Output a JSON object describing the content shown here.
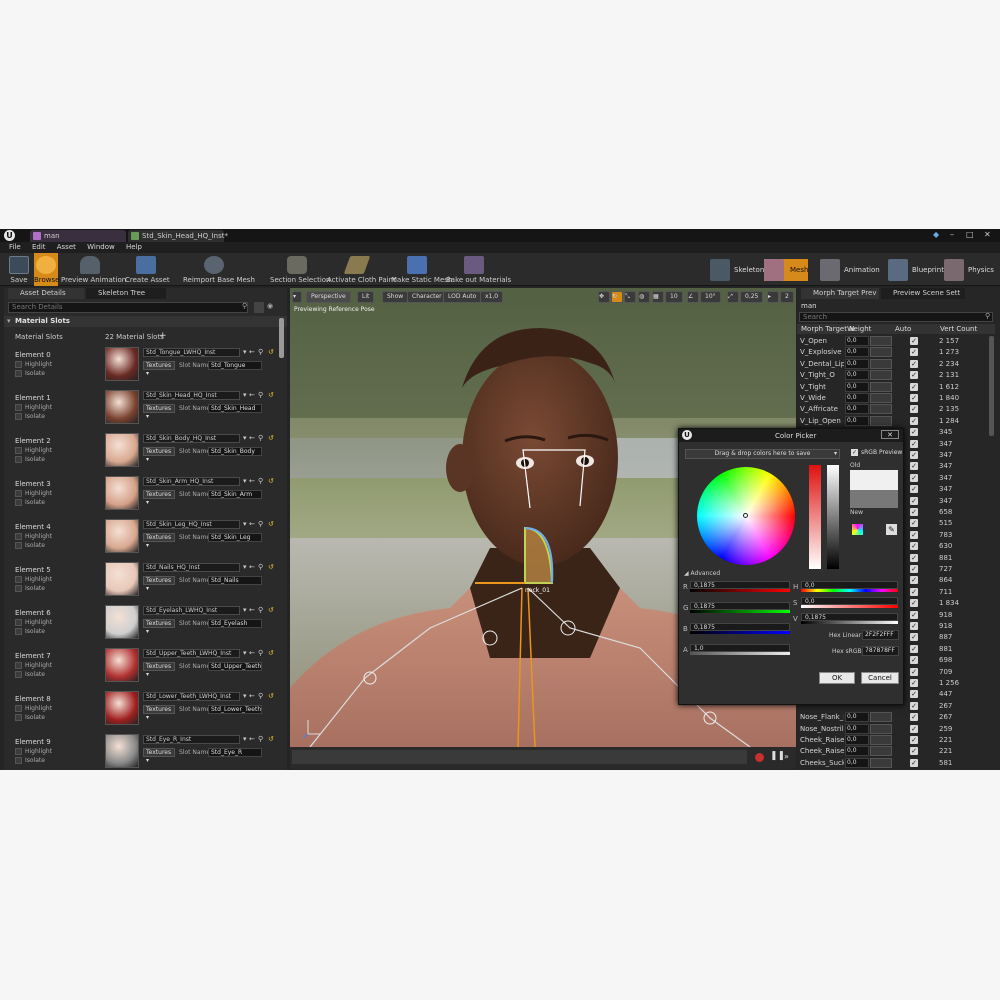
{
  "titlebar": {
    "tabs": [
      "man",
      "Std_Skin_Head_HQ_Inst*"
    ]
  },
  "menu": [
    "File",
    "Edit",
    "Asset",
    "Window",
    "Help"
  ],
  "toolbar": {
    "buttons": [
      "Save",
      "Browse",
      "Preview Animation",
      "Create Asset",
      "Reimport Base Mesh",
      "Section Selection",
      "Activate Cloth Paint",
      "Make Static Mesh",
      "Bake out Materials"
    ],
    "modes": [
      "Skeleton",
      "Mesh",
      "Animation",
      "Blueprint",
      "Physics"
    ]
  },
  "left": {
    "tabs": [
      "Asset Details",
      "Skeleton Tree"
    ],
    "search_placeholder": "Search Details",
    "section": "Material Slots",
    "slots_label": "Material Slots",
    "slots_count": "22 Material Slots",
    "texture_label": "Textures",
    "slot_name_label": "Slot Name",
    "highlight": "Highlight",
    "isolate": "Isolate",
    "elements": [
      {
        "name": "Element 0",
        "material": "Std_Tongue_LWHQ_Inst",
        "slot": "Std_Tongue"
      },
      {
        "name": "Element 1",
        "material": "Std_Skin_Head_HQ_Inst",
        "slot": "Std_Skin_Head"
      },
      {
        "name": "Element 2",
        "material": "Std_Skin_Body_HQ_Inst",
        "slot": "Std_Skin_Body"
      },
      {
        "name": "Element 3",
        "material": "Std_Skin_Arm_HQ_Inst",
        "slot": "Std_Skin_Arm"
      },
      {
        "name": "Element 4",
        "material": "Std_Skin_Leg_HQ_Inst",
        "slot": "Std_Skin_Leg"
      },
      {
        "name": "Element 5",
        "material": "Std_Nails_HQ_Inst",
        "slot": "Std_Nails"
      },
      {
        "name": "Element 6",
        "material": "Std_Eyelash_LWHQ_Inst",
        "slot": "Std_Eyelash"
      },
      {
        "name": "Element 7",
        "material": "Std_Upper_Teeth_LWHQ_Inst",
        "slot": "Std_Upper_Teeth"
      },
      {
        "name": "Element 8",
        "material": "Std_Lower_Teeth_LWHQ_Inst",
        "slot": "Std_Lower_Teeth"
      },
      {
        "name": "Element 9",
        "material": "Std_Eye_R_Inst",
        "slot": "Std_Eye_R"
      }
    ]
  },
  "viewport": {
    "buttons": [
      "Perspective",
      "Lit",
      "Show",
      "Character",
      "LOD Auto",
      "x1,0"
    ],
    "snap": [
      "10",
      "10°",
      "0,25",
      "2"
    ],
    "overlay": "Previewing Reference Pose",
    "bone_label": "neck_01"
  },
  "right": {
    "tabs": [
      "Morph Target Prev",
      "Preview Scene Sett"
    ],
    "asset": "man",
    "search_placeholder": "Search",
    "headers": [
      "Morph Target N",
      "Weight",
      "Auto",
      "Vert Count"
    ],
    "rows": [
      {
        "name": "V_Open",
        "weight": "0,0",
        "count": "2 157"
      },
      {
        "name": "V_Explosive",
        "weight": "0,0",
        "count": "1 273"
      },
      {
        "name": "V_Dental_Lip",
        "weight": "0,0",
        "count": "2 234"
      },
      {
        "name": "V_Tight_O",
        "weight": "0,0",
        "count": "2 131"
      },
      {
        "name": "V_Tight",
        "weight": "0,0",
        "count": "1 612"
      },
      {
        "name": "V_Wide",
        "weight": "0,0",
        "count": "1 840"
      },
      {
        "name": "V_Affricate",
        "weight": "0,0",
        "count": "2 135"
      },
      {
        "name": "V_Lip_Open",
        "weight": "0,0",
        "count": "1 284"
      },
      {
        "name": "",
        "weight": "",
        "count": "345"
      },
      {
        "name": "",
        "weight": "",
        "count": "347"
      },
      {
        "name": "",
        "weight": "",
        "count": "347"
      },
      {
        "name": "",
        "weight": "",
        "count": "347"
      },
      {
        "name": "",
        "weight": "",
        "count": "347"
      },
      {
        "name": "",
        "weight": "",
        "count": "347"
      },
      {
        "name": "",
        "weight": "",
        "count": "347"
      },
      {
        "name": "",
        "weight": "",
        "count": "658"
      },
      {
        "name": "",
        "weight": "",
        "count": "515"
      },
      {
        "name": "",
        "weight": "",
        "count": "783"
      },
      {
        "name": "",
        "weight": "",
        "count": "630"
      },
      {
        "name": "",
        "weight": "",
        "count": "881"
      },
      {
        "name": "",
        "weight": "",
        "count": "727"
      },
      {
        "name": "",
        "weight": "",
        "count": "864"
      },
      {
        "name": "",
        "weight": "",
        "count": "711"
      },
      {
        "name": "",
        "weight": "",
        "count": "1 834"
      },
      {
        "name": "",
        "weight": "",
        "count": "918"
      },
      {
        "name": "",
        "weight": "",
        "count": "918"
      },
      {
        "name": "",
        "weight": "",
        "count": "887"
      },
      {
        "name": "",
        "weight": "",
        "count": "881"
      },
      {
        "name": "",
        "weight": "",
        "count": "698"
      },
      {
        "name": "",
        "weight": "",
        "count": "709"
      },
      {
        "name": "",
        "weight": "",
        "count": "1 256"
      },
      {
        "name": "",
        "weight": "",
        "count": "447"
      },
      {
        "name": "",
        "weight": "",
        "count": "267"
      },
      {
        "name": "Nose_Flank_R",
        "weight": "0,0",
        "count": "267"
      },
      {
        "name": "Nose_Nostrils_F",
        "weight": "0,0",
        "count": "259"
      },
      {
        "name": "Cheek_Raise_L",
        "weight": "0,0",
        "count": "221"
      },
      {
        "name": "Cheek_Raise_R",
        "weight": "0,0",
        "count": "221"
      },
      {
        "name": "Cheeks_Suck",
        "weight": "0,0",
        "count": "581"
      }
    ]
  },
  "picker": {
    "title": "Color Picker",
    "swatch_hint": "Drag & drop colors here to save",
    "srgb": "sRGB Preview",
    "old": "Old",
    "new": "New",
    "advanced": "Advanced",
    "rows_left": [
      {
        "label": "R",
        "value": "0,1875"
      },
      {
        "label": "G",
        "value": "0,1875"
      },
      {
        "label": "B",
        "value": "0,1875"
      },
      {
        "label": "A",
        "value": "1,0"
      }
    ],
    "rows_right": [
      {
        "label": "H",
        "value": "0,0"
      },
      {
        "label": "S",
        "value": "0,0"
      },
      {
        "label": "V",
        "value": "0,1875"
      }
    ],
    "hex_linear_label": "Hex Linear",
    "hex_linear": "2F2F2FFF",
    "hex_srgb_label": "Hex sRGB",
    "hex_srgb": "787878FF",
    "ok": "OK",
    "cancel": "Cancel"
  },
  "colors": {
    "accent": "#e8961e",
    "panel": "#2a2a2a",
    "dark": "#151515"
  }
}
